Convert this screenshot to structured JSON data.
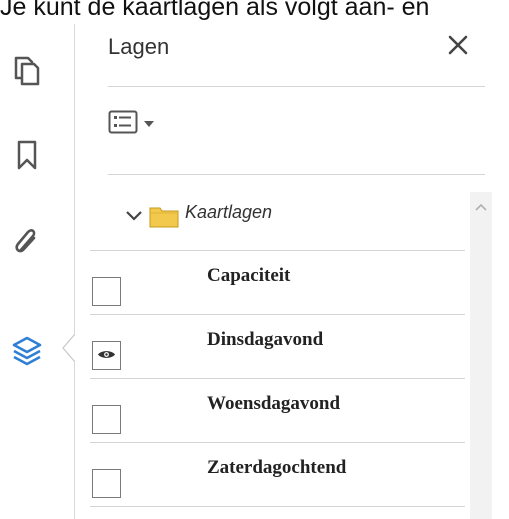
{
  "top_text": "Je kunt de kaartlagen als volgt aan- en",
  "panel": {
    "title": "Lagen"
  },
  "tree": {
    "folder_label": "Kaartlagen",
    "layers": [
      {
        "label": "Capaciteit",
        "visible": false
      },
      {
        "label": "Dinsdagavond",
        "visible": true
      },
      {
        "label": "Woensdagavond",
        "visible": false
      },
      {
        "label": "Zaterdagochtend",
        "visible": false
      }
    ]
  },
  "icons": {
    "toolbar": [
      "pages-icon",
      "bookmark-icon",
      "attachment-icon",
      "layers-icon"
    ],
    "panel": [
      "close-icon",
      "options-icon",
      "chevron-down-icon",
      "folder-icon",
      "eye-icon"
    ]
  },
  "colors": {
    "accent": "#2f7fd6",
    "folder": "#f2c94c",
    "icon_gray": "#555555"
  }
}
